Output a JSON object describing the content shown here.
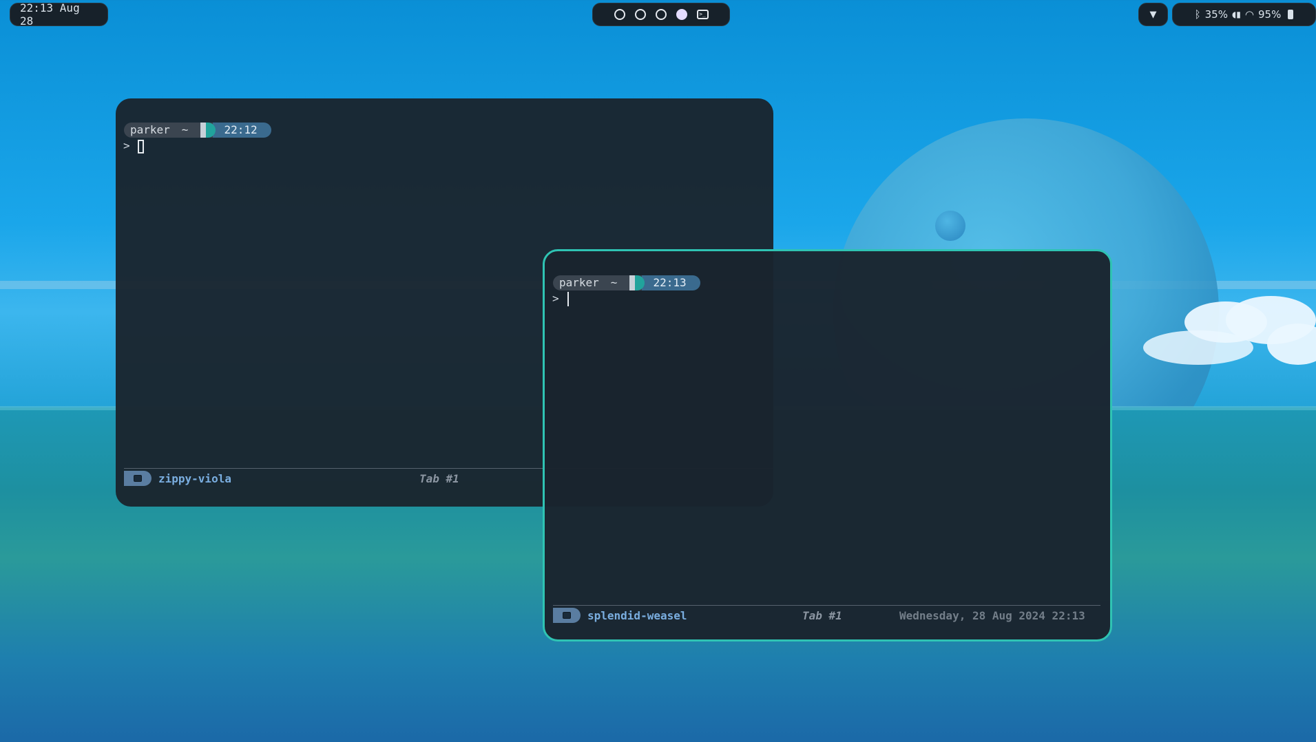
{
  "topbar": {
    "clock": "22:13 Aug 28",
    "workspaces": [
      {
        "state": "empty"
      },
      {
        "state": "empty"
      },
      {
        "state": "empty"
      },
      {
        "state": "active"
      }
    ],
    "bluetooth_level": "35%",
    "wifi_level": "95%"
  },
  "terminals": [
    {
      "user": "parker",
      "dir": "~",
      "time": "22:12",
      "prompt_symbol": ">",
      "tab_name": "zippy-viola",
      "tab_label": "Tab #1",
      "date": ""
    },
    {
      "user": "parker",
      "dir": "~",
      "time": "22:13",
      "prompt_symbol": ">",
      "tab_name": "splendid-weasel",
      "tab_label": "Tab #1",
      "date": "Wednesday, 28 Aug 2024 22:13"
    }
  ],
  "colors": {
    "accent": "#2fc3b3",
    "time_segment": "#3a6a8e",
    "tab_name": "#7aaee0"
  }
}
